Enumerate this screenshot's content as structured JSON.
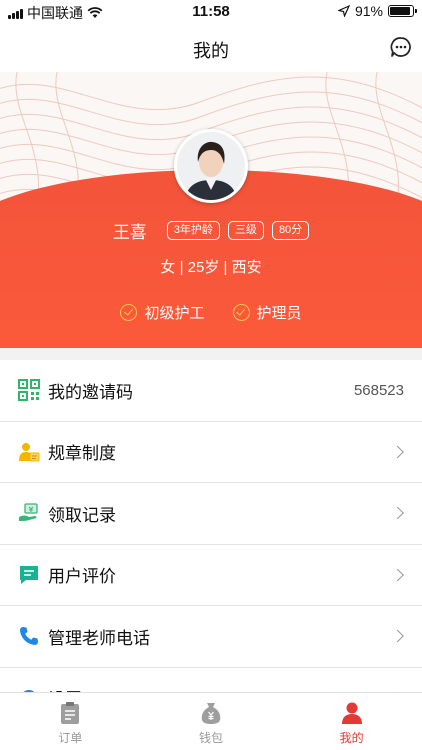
{
  "status_bar": {
    "carrier": "中国联通",
    "time": "11:58",
    "battery": "91%",
    "battery_level": 0.91
  },
  "nav": {
    "title": "我的",
    "message_icon": "chat-bubble-icon"
  },
  "profile": {
    "name": "王喜",
    "tags": [
      "3年护龄",
      "三级",
      "80分"
    ],
    "meta": "女 | 25岁 | 西安",
    "badges": [
      "初级护工",
      "护理员"
    ]
  },
  "menu": [
    {
      "label": "我的邀请码",
      "value": "568523",
      "icon": "qr-code-icon"
    },
    {
      "label": "规章制度",
      "icon": "rules-icon"
    },
    {
      "label": "领取记录",
      "icon": "receive-record-icon"
    },
    {
      "label": "用户评价",
      "icon": "comment-icon"
    },
    {
      "label": "管理老师电话",
      "icon": "phone-icon"
    },
    {
      "label": "设置",
      "icon": "settings-icon"
    }
  ],
  "tabs": [
    {
      "label": "订单",
      "icon": "clipboard-icon"
    },
    {
      "label": "钱包",
      "icon": "money-bag-icon"
    },
    {
      "label": "我的",
      "icon": "user-icon",
      "active": true
    }
  ],
  "colors": {
    "accent": "#f3543a",
    "tab_active": "#e53935",
    "check": "#ffc84a"
  }
}
